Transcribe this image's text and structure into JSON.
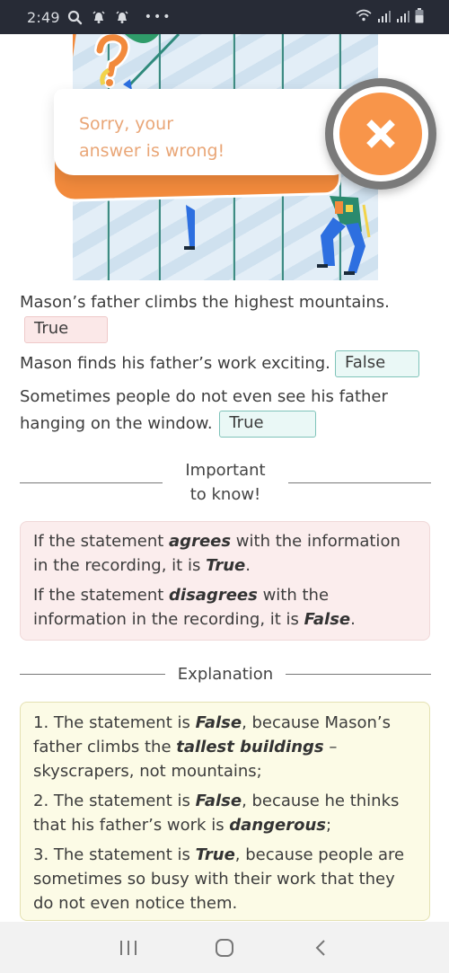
{
  "status_bar": {
    "time": "2:49",
    "left_icons": [
      "search-icon",
      "alarm-icon",
      "alarm-icon",
      "more-dots-icon"
    ],
    "more_dots": "•••",
    "right_icons": [
      "wifi-icon",
      "signal-icon",
      "signal-icon",
      "battery-icon"
    ]
  },
  "feedback": {
    "line1": "Sorry, your",
    "line2": "answer is wrong!",
    "icon": "close-x-icon",
    "colors": {
      "accent": "#f8954a",
      "text": "#e9a677",
      "ring": "#7a7a7a"
    }
  },
  "questions": [
    {
      "text": "Mason’s father climbs the highest mountains.",
      "answer": "True",
      "status": "wrong"
    },
    {
      "text": "Mason finds his father’s work exciting.",
      "answer": "False",
      "status": "correct"
    },
    {
      "text": "Sometimes people do not even see his father hanging on the window.",
      "answer": "True",
      "status": "correct"
    }
  ],
  "important": {
    "title": "Important to know!",
    "rule1": {
      "pre": "If the statement ",
      "key": "agrees",
      "mid": " with the information in the recording, it is ",
      "value": "True",
      "post": "."
    },
    "rule2": {
      "pre": "If the statement ",
      "key": "disagrees",
      "mid": " with the information in the recording, it is ",
      "value": "False",
      "post": "."
    }
  },
  "explanation": {
    "title": "Explanation",
    "items": [
      {
        "pre": "1. The statement is ",
        "value": "False",
        "mid": ", because Mason’s father climbs the ",
        "key": "tallest buildings",
        "post": " – skyscrapers, not mountains;"
      },
      {
        "pre": "2. The statement is ",
        "value": "False",
        "mid": ", because he thinks that his father’s work is ",
        "key": "dangerous",
        "post": ";"
      },
      {
        "pre": "3. The statement is ",
        "value": "True",
        "post": ", because people are sometimes so busy with their work that they do not even notice them."
      }
    ]
  },
  "nav_bar": {
    "buttons": [
      "recent-apps-icon",
      "home-icon",
      "back-icon"
    ]
  }
}
